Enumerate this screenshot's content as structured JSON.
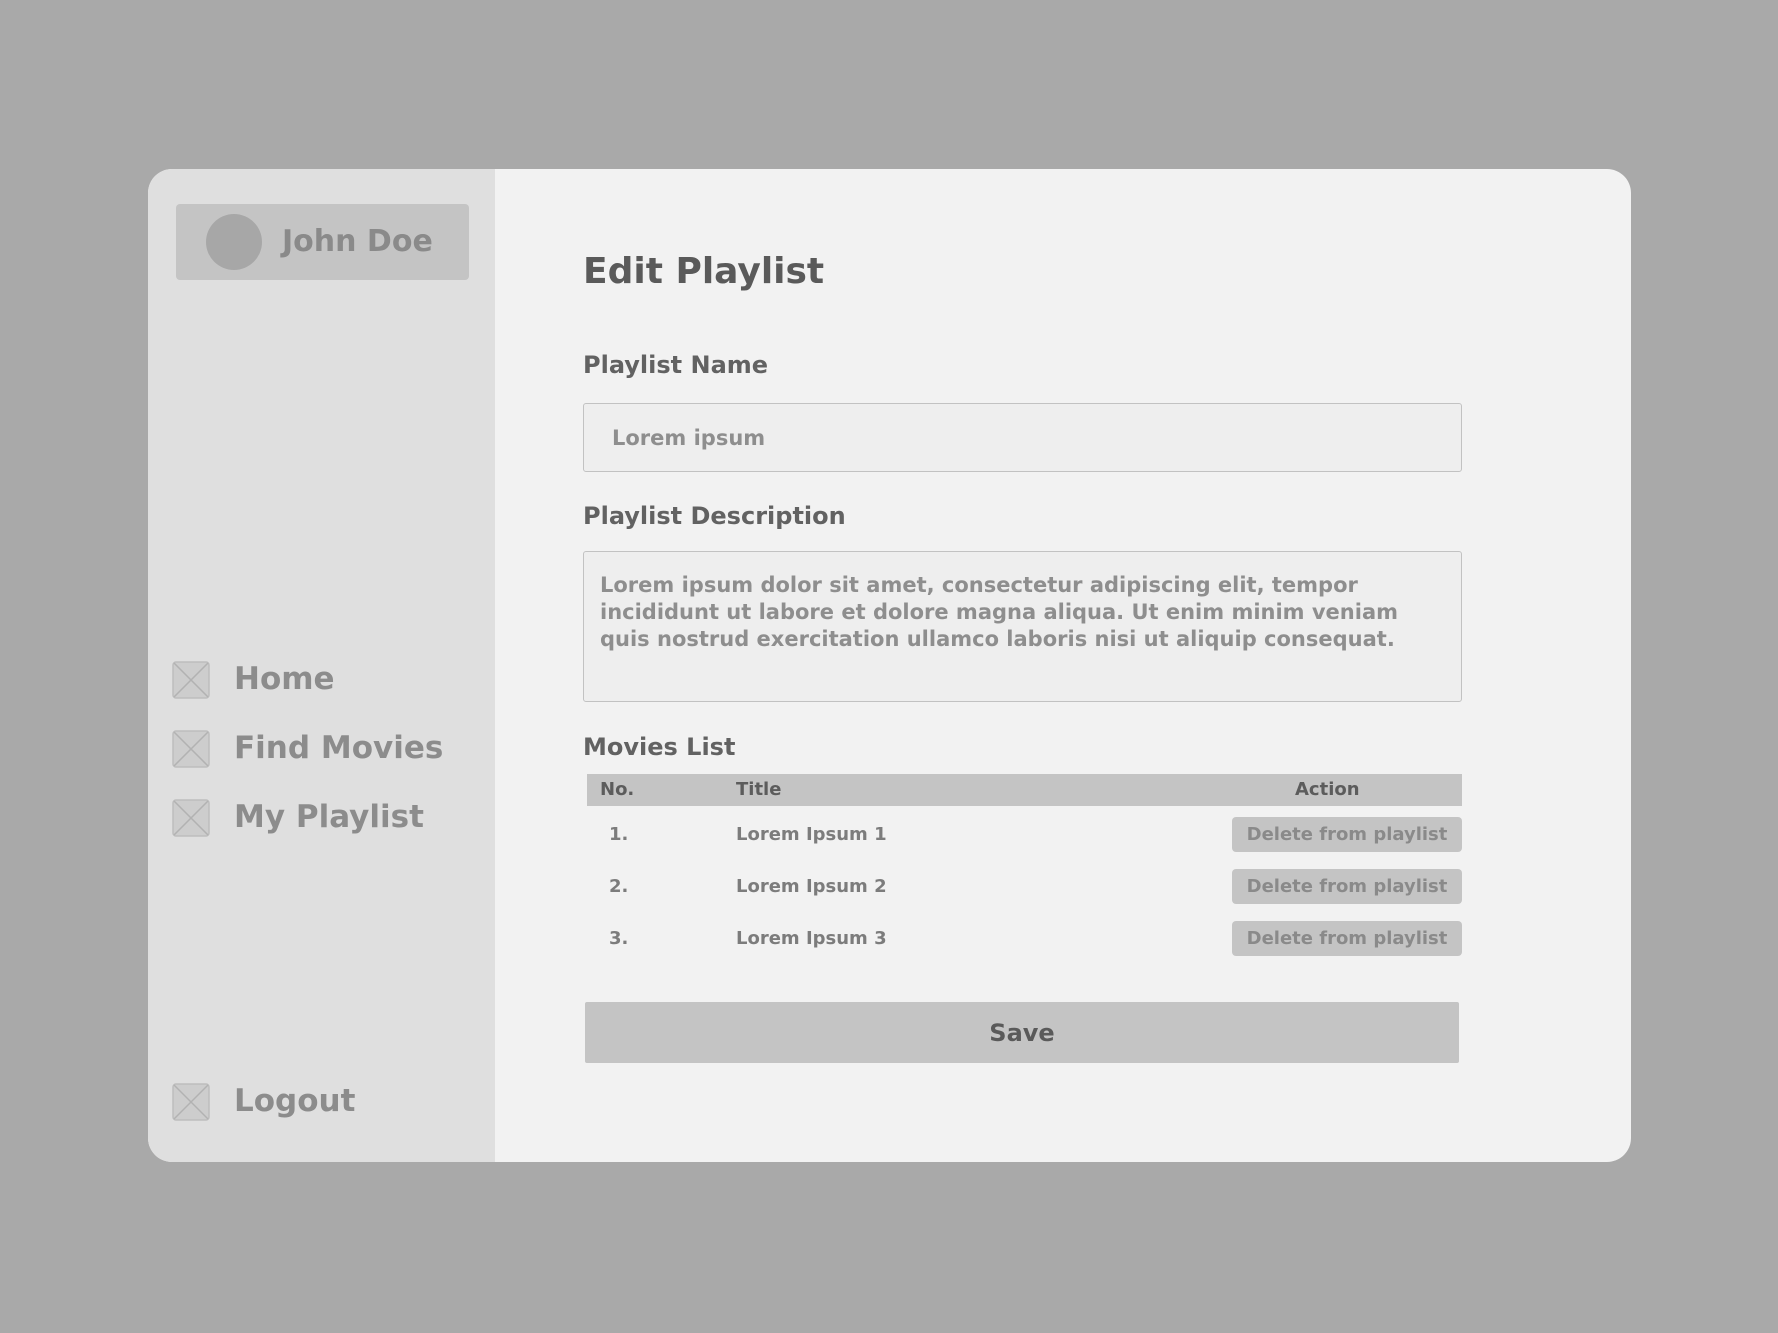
{
  "sidebar": {
    "user": {
      "name": "John Doe",
      "avatar_icon": "avatar-circle"
    },
    "nav": [
      {
        "label": "Home",
        "icon": "image-placeholder-icon"
      },
      {
        "label": "Find Movies",
        "icon": "image-placeholder-icon"
      },
      {
        "label": "My Playlist",
        "icon": "image-placeholder-icon"
      }
    ],
    "logout": {
      "label": "Logout",
      "icon": "image-placeholder-icon"
    }
  },
  "main": {
    "title": "Edit Playlist",
    "name_field": {
      "label": "Playlist Name",
      "placeholder": "Lorem ipsum"
    },
    "description_field": {
      "label": "Playlist Description",
      "value": "Lorem ipsum dolor sit amet, consectetur adipiscing elit, tempor incididunt ut labore et dolore magna aliqua. Ut enim minim veniam quis nostrud exercitation ullamco laboris nisi ut aliquip consequat."
    },
    "movies": {
      "label": "Movies List",
      "columns": [
        "No.",
        "Title",
        "Action"
      ],
      "rows": [
        {
          "no": "1.",
          "title": "Lorem Ipsum 1",
          "action": "Delete from playlist"
        },
        {
          "no": "2.",
          "title": "Lorem Ipsum 2",
          "action": "Delete from playlist"
        },
        {
          "no": "3.",
          "title": "Lorem Ipsum 3",
          "action": "Delete from playlist"
        }
      ]
    },
    "save_label": "Save"
  },
  "colors": {
    "backdrop": "#a9a9a9",
    "window": "#f2f2f2",
    "sidebar": "#dfdfdf",
    "chip": "#c4c4c4",
    "heading": "#5a5a5a",
    "muted_text": "#8c8c8c"
  }
}
